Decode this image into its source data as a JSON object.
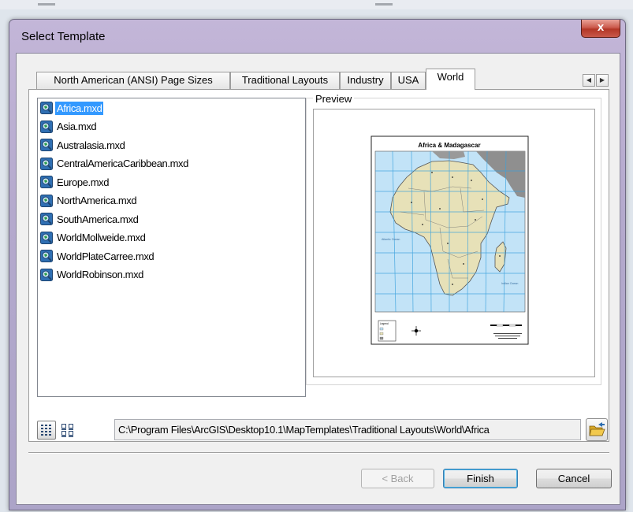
{
  "window": {
    "title": "Select Template",
    "close_label": "x"
  },
  "tabs": [
    {
      "label": "North American (ANSI) Page Sizes"
    },
    {
      "label": "Traditional Layouts"
    },
    {
      "label": "Industry"
    },
    {
      "label": "USA"
    },
    {
      "label": "World"
    }
  ],
  "templates": [
    {
      "label": "Africa.mxd"
    },
    {
      "label": "Asia.mxd"
    },
    {
      "label": "Australasia.mxd"
    },
    {
      "label": "CentralAmericaCaribbean.mxd"
    },
    {
      "label": "Europe.mxd"
    },
    {
      "label": "NorthAmerica.mxd"
    },
    {
      "label": "SouthAmerica.mxd"
    },
    {
      "label": "WorldMollweide.mxd"
    },
    {
      "label": "WorldPlateCarree.mxd"
    },
    {
      "label": "WorldRobinson.mxd"
    }
  ],
  "preview": {
    "group_label": "Preview",
    "map_title": "Africa & Madagascar",
    "ocean_label_1": "Atlantic Ocean",
    "ocean_label_2": "Indian Ocean",
    "legend_title": "Legend"
  },
  "path": {
    "value": "C:\\Program Files\\ArcGIS\\Desktop10.1\\MapTemplates\\Traditional Layouts\\World\\Africa"
  },
  "buttons": {
    "back": "< Back",
    "finish": "Finish",
    "cancel": "Cancel"
  },
  "colors": {
    "selection": "#3399ff",
    "sea": "#c2e3f7",
    "land": "#e7e1b8",
    "graticule": "#3aa1dd"
  }
}
